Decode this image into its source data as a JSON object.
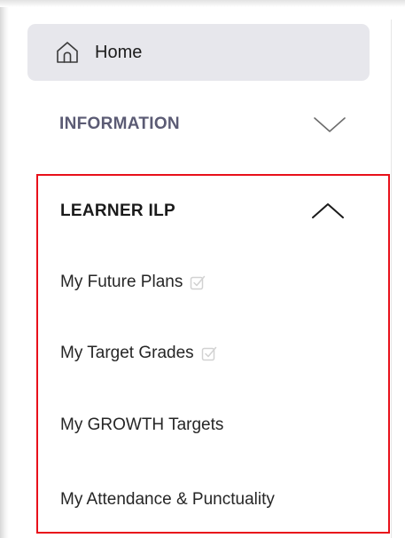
{
  "nav": {
    "home": {
      "label": "Home",
      "icon": "home-icon"
    },
    "information": {
      "label": "INFORMATION",
      "state": "collapsed",
      "icon": "chevron-down-icon"
    },
    "learner_ilp": {
      "label": "LEARNER ILP",
      "state": "expanded",
      "icon": "chevron-up-icon",
      "items": [
        {
          "label": "My Future Plans",
          "icon": "check-icon"
        },
        {
          "label": "My Target Grades",
          "icon": "check-icon"
        },
        {
          "label": "My GROWTH Targets"
        },
        {
          "label": "My Attendance & Punctuality"
        }
      ]
    }
  },
  "colors": {
    "active_background": "#e7e7ec",
    "muted_heading": "#5b5b74",
    "highlight_border": "#e8101a",
    "check_icon": "#d2d2d2"
  }
}
